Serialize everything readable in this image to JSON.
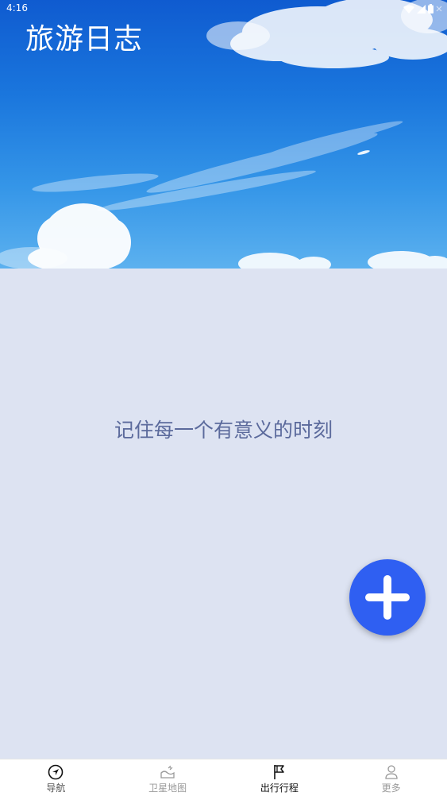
{
  "status_bar": {
    "time": "4:16"
  },
  "header": {
    "title": "旅游日志"
  },
  "main": {
    "empty_message": "记住每一个有意义的时刻"
  },
  "fab": {
    "icon": "plus-icon",
    "color": "#2f5ff2"
  },
  "bottom_nav": {
    "items": [
      {
        "label": "导航",
        "icon": "navigation-arrow-icon",
        "active": false
      },
      {
        "label": "卫星地图",
        "icon": "satellite-map-icon",
        "active": false
      },
      {
        "label": "出行行程",
        "icon": "flag-icon",
        "active": true
      },
      {
        "label": "更多",
        "icon": "person-icon",
        "active": false
      }
    ]
  },
  "colors": {
    "accent": "#2f5ff2",
    "background": "#dde3f2",
    "message_text": "#5b6a9c"
  }
}
